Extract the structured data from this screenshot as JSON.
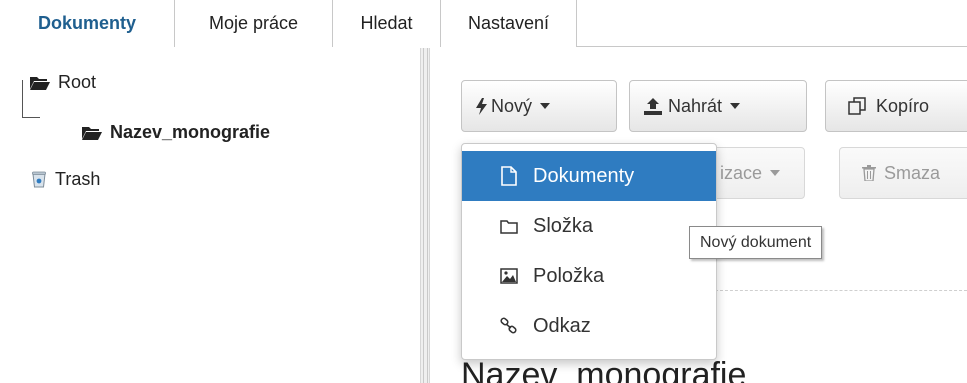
{
  "tabs": [
    {
      "label": "Dokumenty",
      "active": true
    },
    {
      "label": "Moje práce"
    },
    {
      "label": "Hledat"
    },
    {
      "label": "Nastavení"
    }
  ],
  "tree": {
    "root_label": "Root",
    "child_label": "Nazev_monografie",
    "trash_label": "Trash"
  },
  "toolbar": {
    "new_label": "Nový",
    "upload_label": "Nahrát",
    "copy_label": "Kopíro",
    "sync_label": "izace",
    "delete_label": "Smaza"
  },
  "dropdown": {
    "items": [
      {
        "label": "Dokumenty",
        "icon": "document-icon",
        "active": true
      },
      {
        "label": "Složka",
        "icon": "folder-icon"
      },
      {
        "label": "Položka",
        "icon": "image-icon"
      },
      {
        "label": "Odkaz",
        "icon": "link-icon"
      }
    ]
  },
  "tooltip": "Nový dokument",
  "content": {
    "title": "Nazev_monografie"
  },
  "colors": {
    "accent": "#2f7cc1",
    "active_tab": "#1f5f8f"
  }
}
